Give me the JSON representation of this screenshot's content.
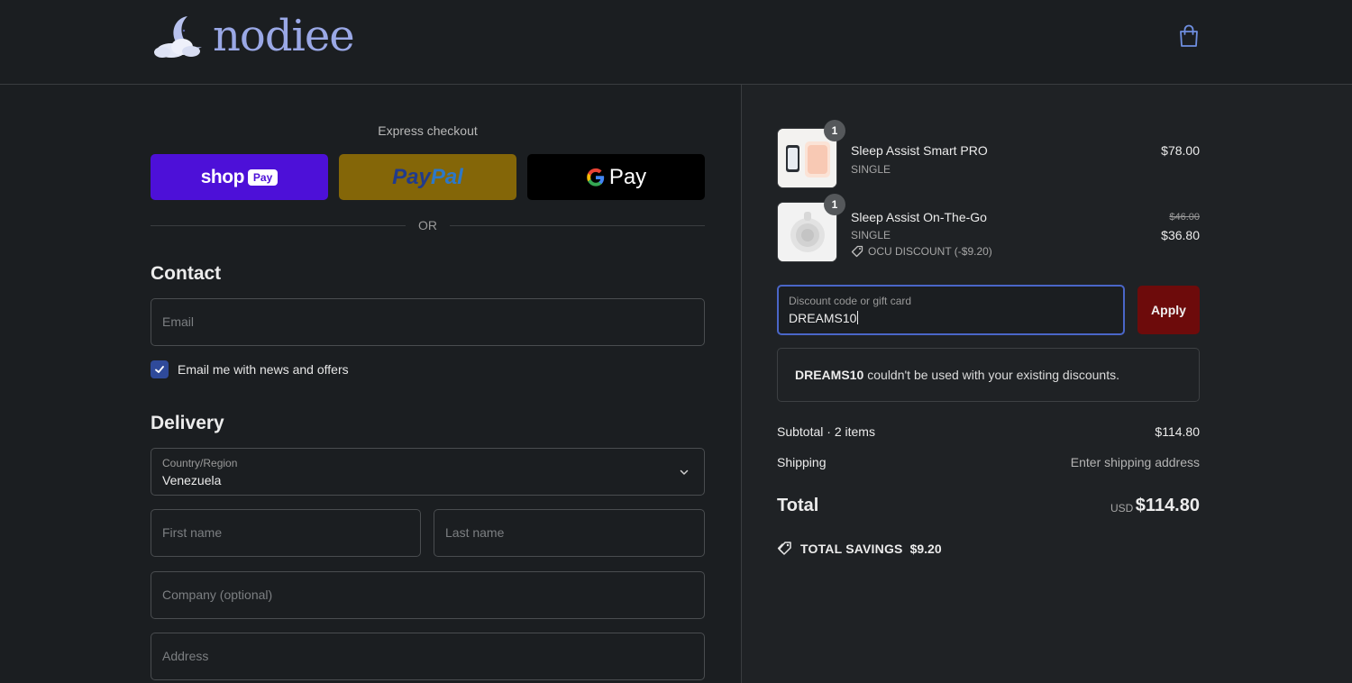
{
  "brand": {
    "name": "nodiee"
  },
  "express": {
    "title": "Express checkout",
    "shop_pay": {
      "word": "shop",
      "badge": "Pay"
    },
    "paypal": {
      "part1": "Pay",
      "part2": "Pal"
    },
    "gpay": {
      "text": "Pay"
    },
    "or_text": "OR"
  },
  "contact": {
    "title": "Contact",
    "email_placeholder": "Email",
    "newsletter_label": "Email me with news and offers",
    "newsletter_checked": true
  },
  "delivery": {
    "title": "Delivery",
    "country_label": "Country/Region",
    "country_value": "Venezuela",
    "first_name_placeholder": "First name",
    "last_name_placeholder": "Last name",
    "company_placeholder": "Company (optional)",
    "address_placeholder": "Address"
  },
  "cart": {
    "items": [
      {
        "name": "Sleep Assist Smart PRO",
        "variant": "SINGLE",
        "quantity": "1",
        "price": "$78.00"
      },
      {
        "name": "Sleep Assist On-The-Go",
        "variant": "SINGLE",
        "quantity": "1",
        "original_price": "$46.00",
        "price": "$36.80",
        "discount": "OCU DISCOUNT (-$9.20)"
      }
    ]
  },
  "discount": {
    "label": "Discount code or gift card",
    "value": "DREAMS10",
    "apply_label": "Apply",
    "error_code": "DREAMS10",
    "error_text": "couldn't be used with your existing discounts."
  },
  "summary": {
    "subtotal_label": "Subtotal · 2 items",
    "subtotal_value": "$114.80",
    "shipping_label": "Shipping",
    "shipping_value": "Enter shipping address",
    "total_label": "Total",
    "currency": "USD",
    "total_value": "$114.80",
    "savings_label": "TOTAL SAVINGS",
    "savings_value": "$9.20"
  },
  "colors": {
    "background": "#1b1e21",
    "shop_pay": "#4d10d8",
    "paypal": "#846608",
    "gpay": "#000000",
    "apply": "#6d0b0b",
    "accent": "#4a66c8"
  }
}
